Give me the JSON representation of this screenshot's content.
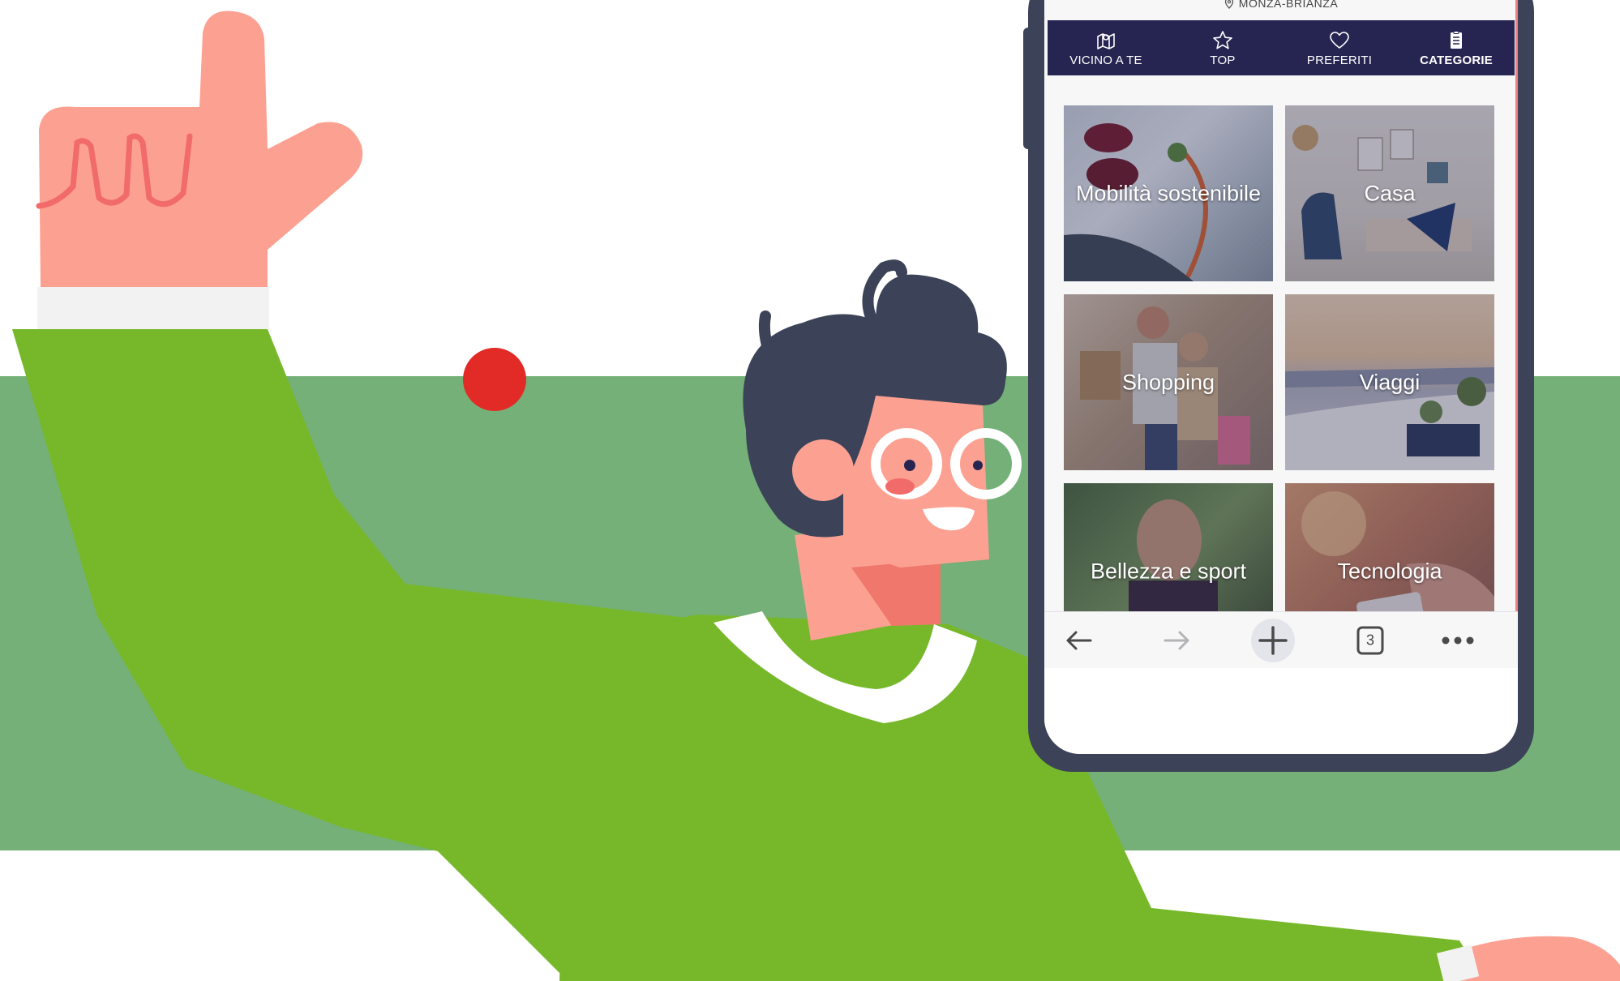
{
  "colors": {
    "band": "#74b077",
    "shirt": "#77b82b",
    "skin": "#fca192",
    "hair": "#3c4257",
    "dot": "#e22b26",
    "navbar": "#262552",
    "phone_frame": "#3c4257"
  },
  "location": {
    "icon": "map-pin-icon",
    "label": "MONZA-BRIANZA"
  },
  "nav": {
    "tabs": [
      {
        "label": "VICINO A TE",
        "icon": "map-icon",
        "active": false
      },
      {
        "label": "TOP",
        "icon": "star-icon",
        "active": false
      },
      {
        "label": "PREFERITI",
        "icon": "heart-icon",
        "active": false
      },
      {
        "label": "CATEGORIE",
        "icon": "list-clipboard-icon",
        "active": true
      }
    ]
  },
  "categories": [
    {
      "label": "Mobilità sostenibile",
      "image": "electric-car-charging"
    },
    {
      "label": "Casa",
      "image": "living-room"
    },
    {
      "label": "Shopping",
      "image": "couple-with-bags"
    },
    {
      "label": "Viaggi",
      "image": "seaside-terrace"
    },
    {
      "label": "Bellezza e sport",
      "image": "smiling-man"
    },
    {
      "label": "Tecnologia",
      "image": "hands-with-phone"
    }
  ],
  "browser_toolbar": {
    "back_icon": "arrow-left-icon",
    "forward_icon": "arrow-right-icon",
    "new_tab_icon": "plus-icon",
    "tab_count": "3",
    "menu_icon": "more-dots-icon"
  }
}
